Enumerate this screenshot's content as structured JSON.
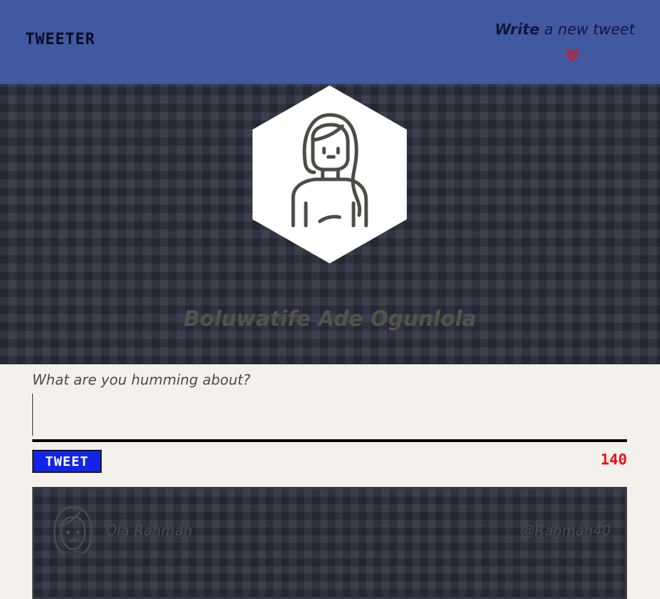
{
  "nav": {
    "brand": "TWEETER",
    "compose_toggle": {
      "strong": "Write",
      "rest": " a new tweet",
      "icon": "double-chevron-down-icon"
    }
  },
  "profile": {
    "name": "Boluwatife Ade Ogunlola",
    "avatar_icon": "woman-avatar-icon"
  },
  "compose": {
    "label": "What are you humming about?",
    "textarea_value": "",
    "button_label": "TWEET",
    "char_count": "140"
  },
  "tweets": [
    {
      "author": "Ola Rahman",
      "handle": "@Rahman40",
      "avatar_icon": "woman-face-icon"
    }
  ],
  "colors": {
    "nav_bg": "#4159a1",
    "hero_bg": "#2e3241",
    "page_bg": "#f4f1ec",
    "tweet_button": "#1124e8",
    "counter": "#e4131b",
    "chevron": "#e4131b"
  }
}
